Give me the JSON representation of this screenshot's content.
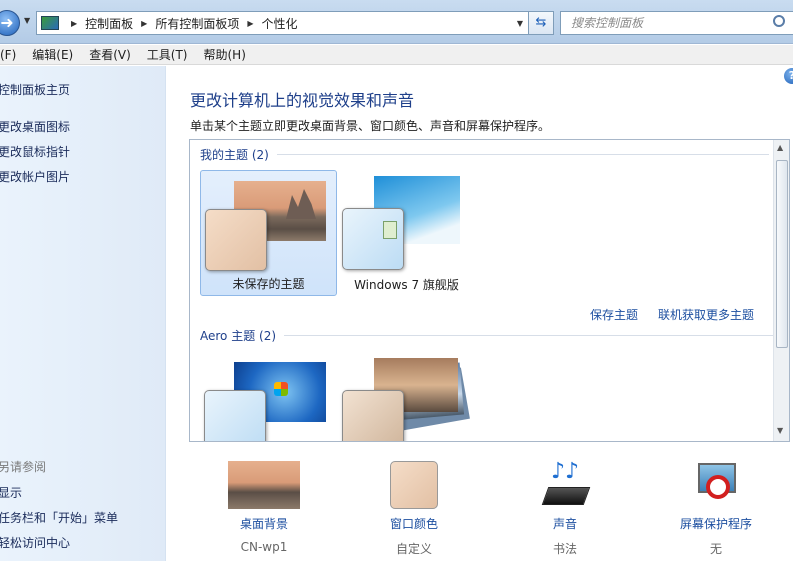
{
  "address_bar": {
    "breadcrumbs": [
      "控制面板",
      "所有控制面板项",
      "个性化"
    ],
    "search_placeholder": "搜索控制面板"
  },
  "menu": [
    "(F)",
    "编辑(E)",
    "查看(V)",
    "工具(T)",
    "帮助(H)"
  ],
  "sidebar": {
    "home": "控制面板主页",
    "links": [
      "更改桌面图标",
      "更改鼠标指针",
      "更改帐户图片"
    ],
    "see_also_heading": "另请参阅",
    "see_also": [
      "显示",
      "任务栏和「开始」菜单",
      "轻松访问中心"
    ]
  },
  "main": {
    "title": "更改计算机上的视觉效果和声音",
    "subtitle": "单击某个主题立即更改桌面背景、窗口颜色、声音和屏幕保护程序。",
    "my_themes_heading": "我的主题 (2)",
    "my_themes": [
      {
        "name": "未保存的主题",
        "selected": true
      },
      {
        "name": "Windows 7 旗舰版",
        "selected": false
      }
    ],
    "save_theme_link": "保存主题",
    "get_more_link": "联机获取更多主题",
    "aero_heading": "Aero 主题 (2)"
  },
  "bottom_items": [
    {
      "label": "桌面背景",
      "value": "CN-wp1"
    },
    {
      "label": "窗口颜色",
      "value": "自定义"
    },
    {
      "label": "声音",
      "value": "书法"
    },
    {
      "label": "屏幕保护程序",
      "value": "无"
    }
  ],
  "colors": {
    "link": "#1d4fa0",
    "title": "#1e3f8a",
    "sidebar_bg": "#e4eef9",
    "selection": "#cfe3fa"
  }
}
